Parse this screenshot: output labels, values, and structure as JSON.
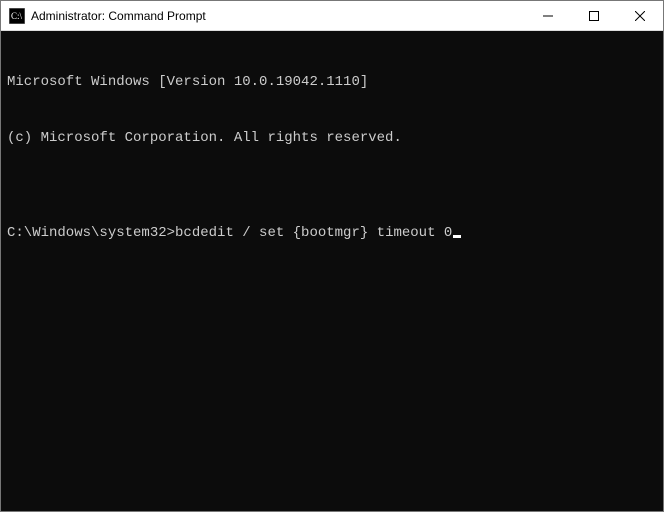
{
  "window": {
    "title": "Administrator: Command Prompt"
  },
  "terminal": {
    "lines": [
      "Microsoft Windows [Version 10.0.19042.1110]",
      "(c) Microsoft Corporation. All rights reserved.",
      ""
    ],
    "prompt": "C:\\Windows\\system32>",
    "command": "bcdedit / set {bootmgr} timeout 0"
  }
}
